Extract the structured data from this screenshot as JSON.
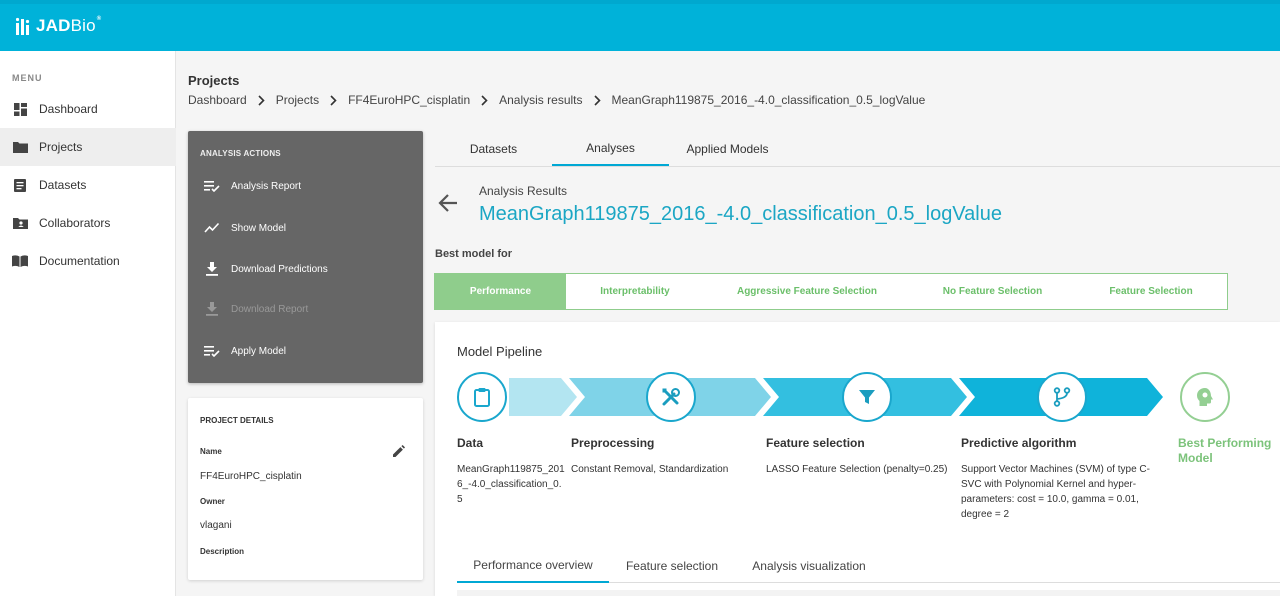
{
  "app": {
    "logo_bold": "JAD",
    "logo_light": "Bio",
    "logo_mark": "®"
  },
  "sidebar": {
    "menu_title": "MENU",
    "items": [
      {
        "label": "Dashboard",
        "icon": "dashboard-icon"
      },
      {
        "label": "Projects",
        "icon": "folder-icon",
        "active": true
      },
      {
        "label": "Datasets",
        "icon": "dataset-icon"
      },
      {
        "label": "Collaborators",
        "icon": "collaborators-icon"
      },
      {
        "label": "Documentation",
        "icon": "book-icon"
      }
    ]
  },
  "header": {
    "title": "Projects",
    "breadcrumb": [
      "Dashboard",
      "Projects",
      "FF4EuroHPC_cisplatin",
      "Analysis results",
      "MeanGraph119875_2016_-4.0_classification_0.5_logValue"
    ]
  },
  "actions": {
    "title": "ANALYSIS ACTIONS",
    "items": [
      {
        "label": "Analysis Report",
        "icon": "report-list-icon",
        "enabled": true
      },
      {
        "label": "Show Model",
        "icon": "trend-line-icon",
        "enabled": true
      },
      {
        "label": "Download Predictions",
        "icon": "download-icon",
        "enabled": true
      },
      {
        "label": "Download Report",
        "icon": "download-icon",
        "enabled": false
      },
      {
        "label": "Apply Model",
        "icon": "apply-list-icon",
        "enabled": true
      }
    ]
  },
  "project_details": {
    "title": "PROJECT DETAILS",
    "name_label": "Name",
    "name_value": "FF4EuroHPC_cisplatin",
    "owner_label": "Owner",
    "owner_value": "vlagani",
    "description_label": "Description"
  },
  "top_tabs": [
    {
      "label": "Datasets"
    },
    {
      "label": "Analyses",
      "active": true
    },
    {
      "label": "Applied Models"
    }
  ],
  "analysis": {
    "label": "Analysis Results",
    "title": "MeanGraph119875_2016_-4.0_classification_0.5_logValue",
    "best_model_for": "Best model for",
    "segments": [
      {
        "label": "Performance",
        "active": true
      },
      {
        "label": "Interpretability"
      },
      {
        "label": "Aggressive Feature Selection"
      },
      {
        "label": "No Feature Selection"
      },
      {
        "label": "Feature Selection"
      }
    ]
  },
  "pipeline": {
    "title": "Model Pipeline",
    "steps": [
      {
        "title": "Data",
        "desc": "MeanGraph119875_2016_-4.0_classification_0.5",
        "icon": "clipboard-icon"
      },
      {
        "title": "Preprocessing",
        "desc": "Constant Removal, Standardization",
        "icon": "tools-icon"
      },
      {
        "title": "Feature selection",
        "desc": "LASSO Feature Selection (penalty=0.25)",
        "icon": "filter-icon"
      },
      {
        "title": "Predictive algorithm",
        "desc": "Support Vector Machines (SVM) of type C-SVC with Polynomial Kernel and hyper-parameters: cost = 10.0, gamma = 0.01, degree = 2",
        "icon": "branch-icon"
      }
    ],
    "best_label": "Best Performing Model",
    "best_icon": "brain-head-icon",
    "colors": {
      "light": "#b3e5f1",
      "mid": "#7fd3e8",
      "strong": "#33bfe0",
      "dark": "#0fb3da"
    }
  },
  "bottom_tabs": [
    {
      "label": "Performance overview",
      "active": true
    },
    {
      "label": "Feature selection"
    },
    {
      "label": "Analysis visualization"
    }
  ]
}
